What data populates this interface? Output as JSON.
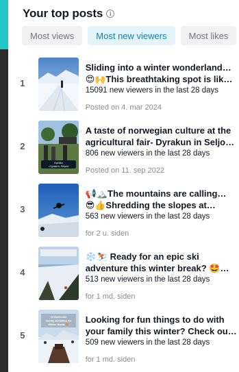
{
  "header": {
    "title": "Your top posts",
    "info_icon": "info-icon"
  },
  "tabs": [
    {
      "label": "Most views",
      "active": false
    },
    {
      "label": "Most new viewers",
      "active": true
    },
    {
      "label": "Most likes",
      "active": false
    }
  ],
  "posts": [
    {
      "rank": "1",
      "line1": "Sliding into a winter wonderland…",
      "line2": "😍🙌This breathtaking spot is lik…",
      "viewers": "15091 new viewers in the last 28 days",
      "posted": "Posted on 4. mar 2024",
      "thumb_overlay": ""
    },
    {
      "rank": "2",
      "line1": "A taste of norwegian culture at the",
      "line2": "agricultural fair- Dyrakun in Seljo…",
      "viewers": "806 new viewers in the last 28 days",
      "posted": "Posted on 11. sep 2022",
      "thumb_overlay": "Dyrsku\n• Dyrsku'n, Seljord"
    },
    {
      "rank": "3",
      "line1": "📢🏔️The mountains are calling…",
      "line2": "😎👍Shredding the slopes at…",
      "viewers": "563 new viewers in the last 28 days",
      "posted": "for 2 u. siden",
      "thumb_overlay": ""
    },
    {
      "rank": "4",
      "line1": "❄️⛷️ Ready for an epic ski",
      "line2": "adventure this winter break? 🤩…",
      "viewers": "513 new viewers in the last 28 days",
      "posted": "for 1 md. siden",
      "thumb_overlay": ""
    },
    {
      "rank": "5",
      "line1": "Looking for fun things to do with",
      "line2": "your family this winter? Check ou…",
      "viewers": "509 new viewers in the last 28 days",
      "posted": "for 1 md. siden",
      "thumb_overlay": "10 Awesome Family Activities for Winter Break 🤩"
    }
  ]
}
